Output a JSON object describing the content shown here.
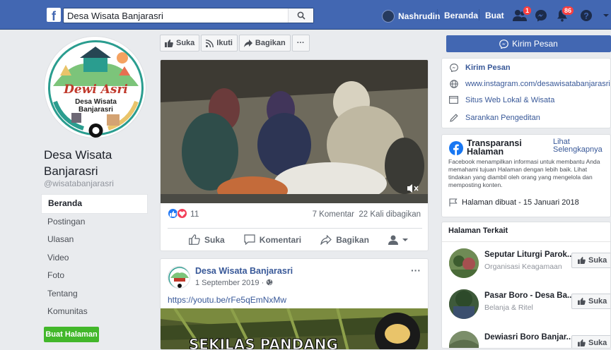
{
  "topbar": {
    "search_value": "Desa Wisata Banjarasri",
    "search_placeholder": "Search",
    "user_name": "Nashrudin",
    "home_label": "Beranda",
    "create_label": "Buat",
    "friends_badge": "1",
    "notif_badge": "86"
  },
  "page": {
    "name": "Desa Wisata Banjarasri",
    "handle": "@wisatabanjarasri",
    "logo_text_1": "Dewi Asri",
    "logo_text_2": "Desa Wisata",
    "logo_text_3": "Banjarasri"
  },
  "nav": {
    "items": [
      "Beranda",
      "Postingan",
      "Ulasan",
      "Video",
      "Foto",
      "Tentang",
      "Komunitas"
    ],
    "active": "Beranda",
    "create_page": "Buat Halaman"
  },
  "action_bar": {
    "like": "Suka",
    "follow": "Ikuti",
    "share": "Bagikan",
    "more": "···"
  },
  "post1": {
    "reaction_count": "11",
    "comments": "7 Komentar",
    "shares": "22 Kali dibagikan",
    "like": "Suka",
    "comment": "Komentari",
    "share": "Bagikan"
  },
  "post2": {
    "author": "Desa Wisata Banjarasri",
    "date": "1 September 2019 ·",
    "link": "https://youtu.be/rFe5qEmNxMw",
    "more": "···",
    "thumb_text": "SEKILAS PANDANG"
  },
  "right": {
    "message_button": "Kirim Pesan",
    "about": [
      {
        "icon": "messenger-icon",
        "text": "Kirim Pesan"
      },
      {
        "icon": "globe-icon",
        "text": "www.instagram.com/desawisatabanjarasri.dev"
      },
      {
        "icon": "website-icon",
        "text": "Situs Web Lokal & Wisata"
      },
      {
        "icon": "pencil-icon",
        "text": "Sarankan Pengeditan"
      }
    ],
    "transparency": {
      "title": "Transparansi Halaman",
      "see_more": "Lihat Selengkapnya",
      "description": "Facebook menampilkan informasi untuk membantu Anda memahami tujuan Halaman dengan lebih baik. Lihat tindakan yang diambil oleh orang yang mengelola dan memposting konten.",
      "created": "Halaman dibuat - 15 Januari 2018"
    },
    "related_title": "Halaman Terkait",
    "related": [
      {
        "name": "Seputar Liturgi Parok...",
        "category": "Organisasi Keagamaan",
        "button": "Suka"
      },
      {
        "name": "Pasar Boro - Desa Ba...",
        "category": "Belanja & Ritel",
        "button": "Suka"
      },
      {
        "name": "Dewiasri Boro Banjar...",
        "category": "",
        "button": "Suka"
      }
    ]
  },
  "colors": {
    "brand_blue": "#4267b2",
    "link_blue": "#385898",
    "green": "#42b72a",
    "badge_red": "#fa3e3e"
  }
}
